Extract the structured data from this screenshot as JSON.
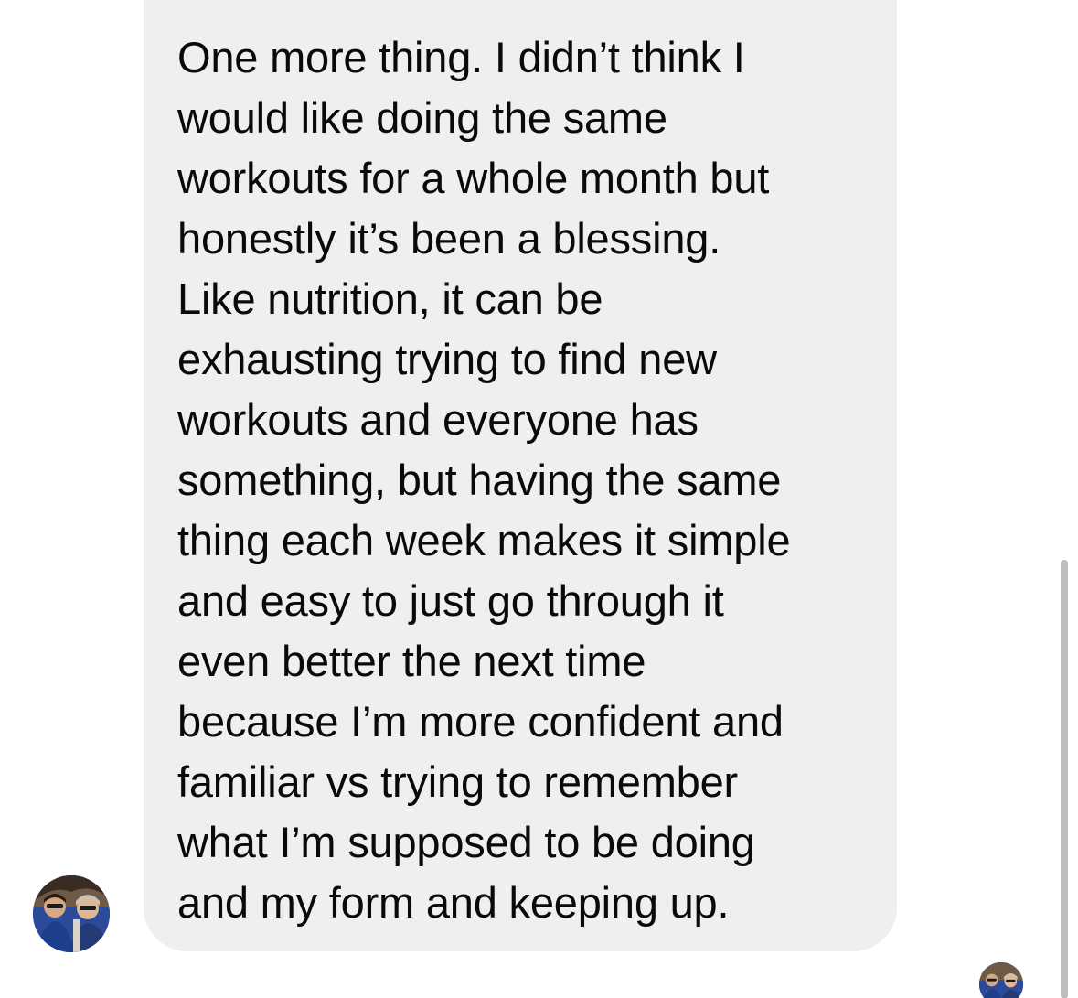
{
  "conversation": {
    "message": {
      "lines": [
        "One more thing. I didn’t think I",
        "would like doing the same",
        "workouts for a whole month but",
        "honestly it’s been a blessing.",
        "Like nutrition, it can be",
        "exhausting trying to find new",
        "workouts and everyone has",
        "something, but having the same",
        "thing each week makes it simple",
        "and easy to just go through it",
        "even better the next time",
        "because I’m more confident and",
        "familiar vs trying to remember",
        "what I’m supposed to be doing",
        "and my form and keeping up."
      ]
    },
    "sender_avatar_icon": "profile-photo-icon",
    "read_receipt_icon": "profile-photo-icon"
  },
  "colors": {
    "bubble_background": "#efefef",
    "text": "#0a0a0a",
    "page_background": "#ffffff",
    "scrollbar": "#bdbdbd"
  }
}
